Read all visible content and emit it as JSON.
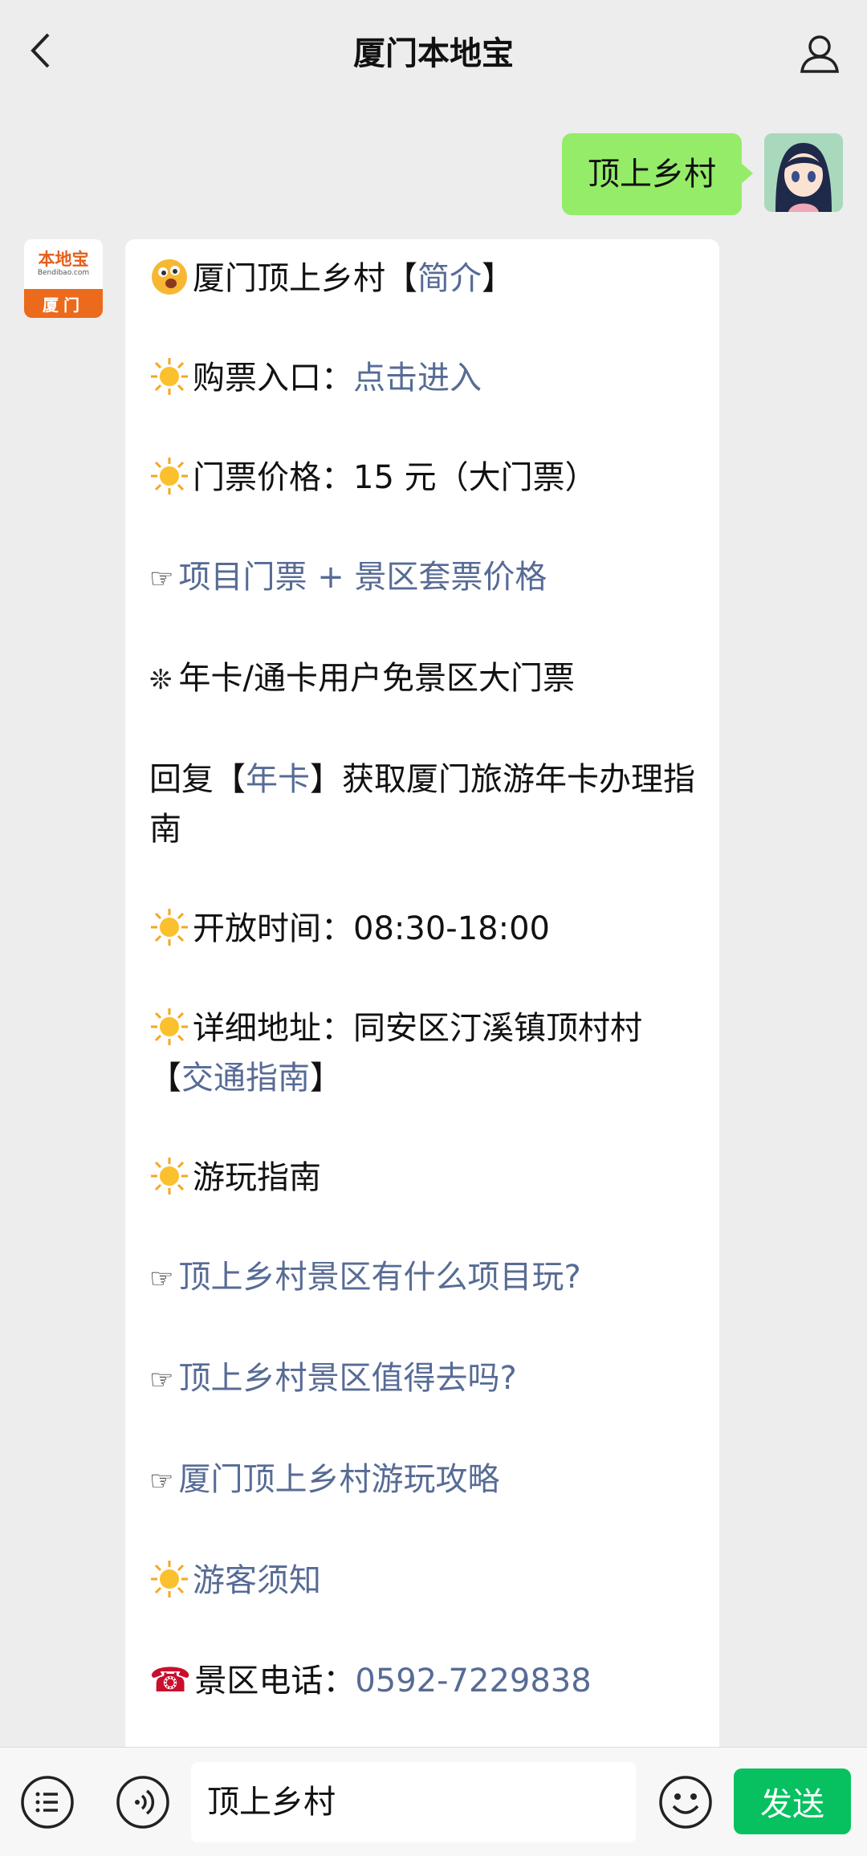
{
  "header": {
    "title": "厦门本地宝",
    "back_icon": "chevron-left-icon",
    "profile_icon": "person-icon"
  },
  "messages": {
    "user": {
      "text": "顶上乡村"
    },
    "bot": {
      "avatar": {
        "logo_main": "本地宝",
        "logo_sub": "Bendibao.com",
        "logo_city": "厦门"
      },
      "lines": [
        {
          "icon": "winking-face-icon",
          "text": "厦门顶上乡村【",
          "link": "简介",
          "suffix": "】"
        },
        {
          "icon": "sun-icon",
          "text": "购票入口：",
          "link": "点击进入"
        },
        {
          "icon": "sun-icon",
          "text": "门票价格：15 元（大门票）"
        },
        {
          "icon": "pointing-hand-icon",
          "link": "项目门票 + 景区套票价格"
        },
        {
          "icon": "sparkle-icon",
          "text": "年卡/通卡用户免景区大门票"
        },
        {
          "prefix": "回复【",
          "link": "年卡",
          "text": "】获取厦门旅游年卡办理指南"
        },
        {
          "icon": "sun-icon",
          "text": "开放时间：08:30-18:00"
        },
        {
          "icon": "sun-icon",
          "text": "详细地址：同安区汀溪镇顶村村",
          "prefix2": "【",
          "link": "交通指南",
          "suffix": "】"
        },
        {
          "icon": "sun-icon",
          "text": "游玩指南"
        },
        {
          "icon": "pointing-hand-icon",
          "link": "顶上乡村景区有什么项目玩?"
        },
        {
          "icon": "pointing-hand-icon",
          "link": "顶上乡村景区值得去吗?"
        },
        {
          "icon": "pointing-hand-icon",
          "link": "厦门顶上乡村游玩攻略"
        },
        {
          "icon": "sun-icon",
          "link": "游客须知"
        },
        {
          "icon": "telephone-icon",
          "text": "景区电话：",
          "link": "0592-7229838"
        }
      ]
    }
  },
  "input_bar": {
    "value": "顶上乡村",
    "send_label": "发送"
  },
  "colors": {
    "accent": "#07c160",
    "bubble": "#95ec69",
    "link": "#576b95",
    "background": "#ededed"
  }
}
